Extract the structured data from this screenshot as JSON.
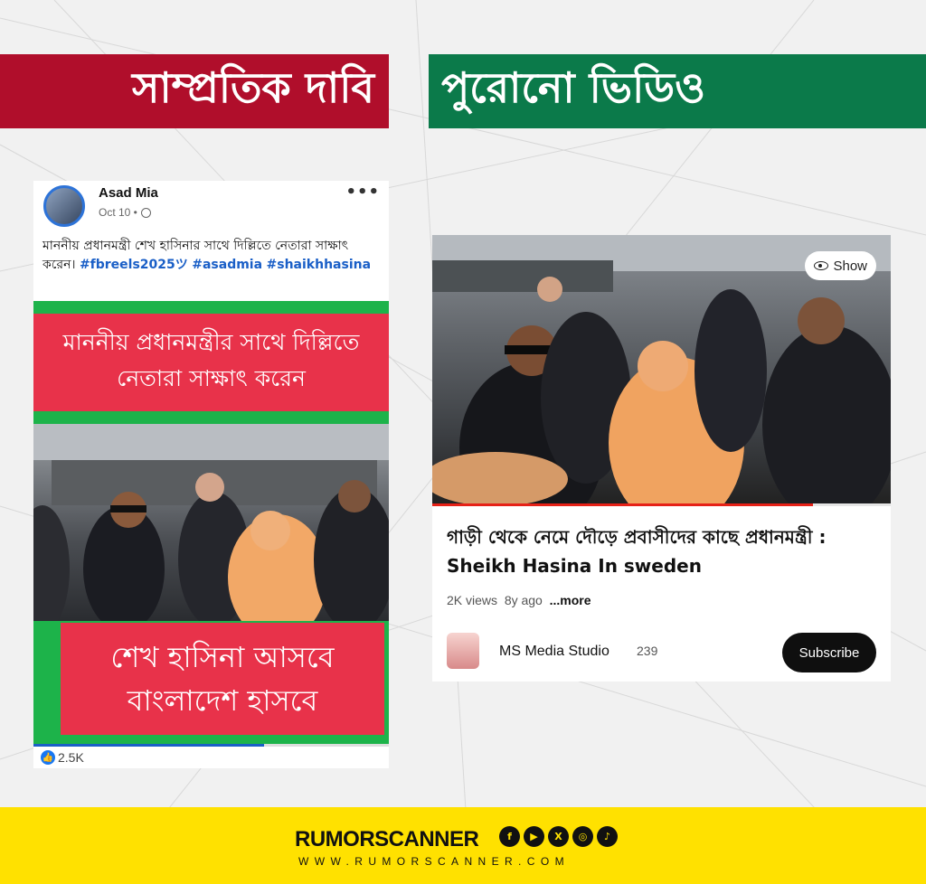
{
  "banners": {
    "left": "সাম্প্রতিক দাবি",
    "right": "পুরোনো ভিডিও"
  },
  "facebook_post": {
    "author": "Asad Mia",
    "date": "Oct 10 •",
    "more_icon": "•••",
    "text": "মাননীয় প্রধানমন্ত্রী শেখ হাসিনার সাথে দিল্লিতে নেতারা সাক্ষাৎ করেন।",
    "hashtags": [
      "#fbreels2025ツ",
      "#asadmia",
      "#shaikhhasina"
    ],
    "reel_caption_top": "মাননীয় প্রধানমন্ত্রীর সাথে দিল্লিতে নেতারা সাক্ষাৎ করেন",
    "reel_caption_bottom": "শেখ হাসিনা আসবে বাংলাদেশ হাসবে",
    "reactions": "2.5K",
    "progress": 0.65
  },
  "youtube_video": {
    "show_label": "Show",
    "title": "গাড়ী থেকে নেমে দৌড়ে প্রবাসীদের কাছে প্রধানমন্ত্রী : Sheikh Hasina In sweden",
    "views": "2K views",
    "age": "8y ago",
    "more": "...more",
    "channel": "MS Media Studio",
    "subscribers": "239",
    "subscribe": "Subscribe",
    "progress": 0.83
  },
  "footer": {
    "brand": "RUMORSCANNER",
    "website": "WWW.RUMORSCANNER.COM",
    "social_icons": [
      "facebook-icon",
      "youtube-icon",
      "x-icon",
      "instagram-icon",
      "tiktok-icon"
    ]
  },
  "colors": {
    "red": "#b00e2b",
    "green": "#0b7a4a",
    "yellow": "#ffe100",
    "reel_red": "#e8324a",
    "reel_green": "#1db34a"
  }
}
